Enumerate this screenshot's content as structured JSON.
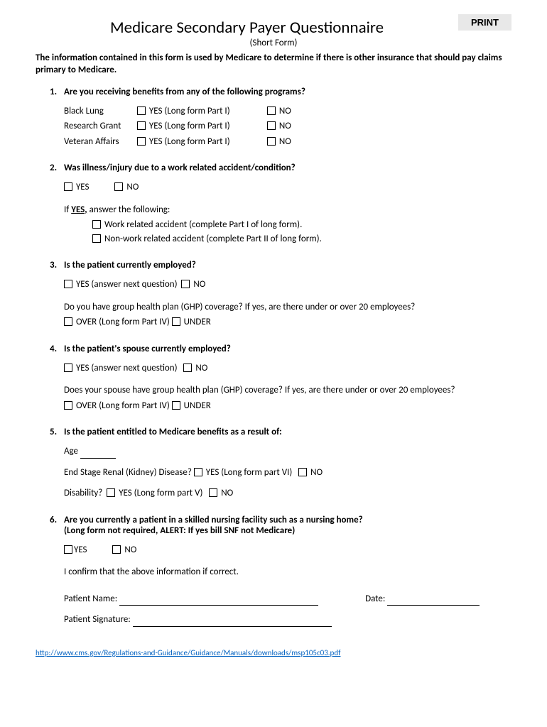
{
  "print_label": "PRINT",
  "title": "Medicare Secondary Payer Questionnaire",
  "subtitle": "(Short Form)",
  "intro": "The information contained in this form is used by Medicare to determine if there is other insurance that should pay claims primary to Medicare.",
  "q1": {
    "num": "1.",
    "text": "Are you receiving benefits from any of the following programs?",
    "rows": [
      {
        "label": "Black Lung",
        "yes": "YES (Long form Part I)",
        "no": "NO"
      },
      {
        "label": "Research Grant",
        "yes": "YES (Long form Part I)",
        "no": "NO"
      },
      {
        "label": "Veteran Affairs",
        "yes": "YES (Long form Part I)",
        "no": "NO"
      }
    ]
  },
  "q2": {
    "num": "2.",
    "text": "Was illness/injury due to a work related accident/condition?",
    "yes": "YES",
    "no": "NO",
    "if_yes_prefix": "If ",
    "if_yes_bold": "YES,",
    "if_yes_suffix": " answer the following:",
    "opt1": "Work related accident (complete Part I of long form).",
    "opt2": "Non-work related accident (complete Part II of long form)."
  },
  "q3": {
    "num": "3.",
    "text": "Is the patient currently employed?",
    "yes": "YES (answer next question)",
    "no": "NO",
    "sub": "Do you have group health plan (GHP) coverage? If yes, are there under or over 20 employees?",
    "over": "OVER (Long form Part IV)",
    "under": "UNDER"
  },
  "q4": {
    "num": "4.",
    "text": "Is the patient's spouse currently employed?",
    "yes": "YES (answer next question)",
    "no": "NO",
    "sub": "Does your spouse have group health plan (GHP) coverage? If yes, are there under or over 20 employees?",
    "over": "OVER (Long form Part IV)",
    "under": "UNDER"
  },
  "q5": {
    "num": "5.",
    "text": "Is the patient entitled to Medicare benefits as a result of:",
    "age_label": "Age",
    "esrd_label": "End Stage Renal (Kidney) Disease?",
    "esrd_yes": "YES (Long form part VI)",
    "esrd_no": "NO",
    "disability_label": "Disability?",
    "disability_yes": "YES (Long form part V)",
    "disability_no": "NO"
  },
  "q6": {
    "num": "6.",
    "text": "Are you currently a patient in a skilled nursing facility such as a nursing home?",
    "text2": "(Long form not required, ALERT: If yes bill SNF not Medicare)",
    "yes": "YES",
    "no": "NO",
    "confirm": "I confirm that the above information if correct.",
    "patient_name": "Patient Name:",
    "date": "Date:",
    "signature": "Patient Signature:"
  },
  "footer_url": "http://www.cms.gov/Regulations-and-Guidance/Guidance/Manuals/downloads/msp105c03.pdf"
}
